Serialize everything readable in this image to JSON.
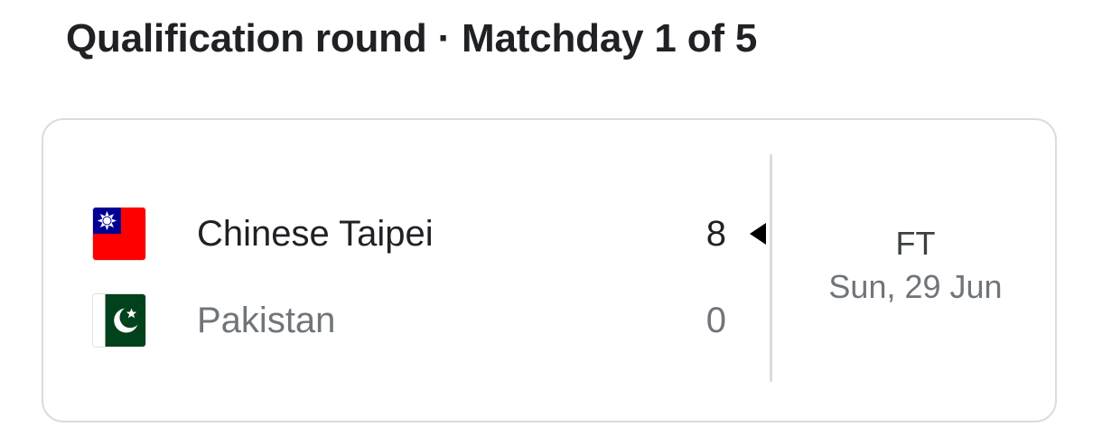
{
  "header": {
    "title": "Qualification round · Matchday 1 of 5"
  },
  "match": {
    "home": {
      "name": "Chinese Taipei",
      "score": "8",
      "flag_icon": "chinese-taipei-flag-icon",
      "is_winner": true
    },
    "away": {
      "name": "Pakistan",
      "score": "0",
      "flag_icon": "pakistan-flag-icon",
      "is_winner": false
    },
    "status": "FT",
    "date": "Sun, 29 Jun"
  },
  "colors": {
    "text_primary": "#202124",
    "text_secondary": "#70757a",
    "border": "#dadce0",
    "taipei_red": "#fe0000",
    "taipei_blue": "#000095",
    "pakistan_green": "#01411c"
  }
}
